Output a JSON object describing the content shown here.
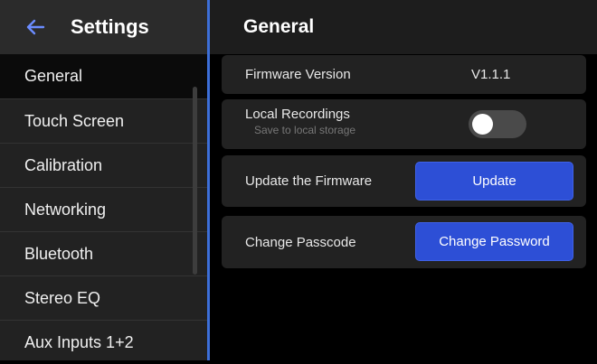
{
  "sidebar": {
    "title": "Settings",
    "back_icon": "arrow-left-icon",
    "items": [
      {
        "label": "General",
        "active": true
      },
      {
        "label": "Touch Screen"
      },
      {
        "label": "Calibration"
      },
      {
        "label": "Networking"
      },
      {
        "label": "Bluetooth"
      },
      {
        "label": "Stereo EQ"
      },
      {
        "label": "Aux Inputs 1+2"
      }
    ]
  },
  "main": {
    "title": "General",
    "firmware": {
      "label": "Firmware Version",
      "value": "V1.1.1"
    },
    "local_recordings": {
      "label": "Local Recordings",
      "sublabel": "Save to local storage",
      "enabled": false
    },
    "update": {
      "label": "Update the Firmware",
      "button": "Update"
    },
    "passcode": {
      "label": "Change Passcode",
      "button": "Change Password"
    }
  },
  "colors": {
    "accent": "#2d4fd6",
    "divider": "#3d6fd8",
    "back_arrow": "#6b8cff"
  }
}
